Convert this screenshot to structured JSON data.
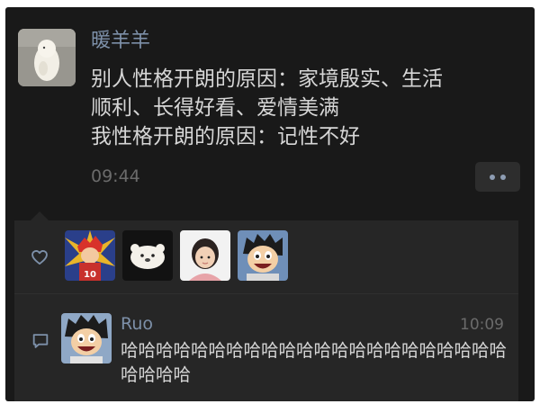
{
  "post": {
    "username": "暖羊羊",
    "text_lines": [
      "别人性格开朗的原因：家境殷实、生活",
      "顺利、长得好看、爱情美满",
      "我性格开朗的原因：记性不好"
    ],
    "time": "09:44",
    "avatar_icon": "white-bird-photo"
  },
  "likes": {
    "icon": "heart-icon",
    "avatars": [
      {
        "icon": "anime-basketball-player-avatar"
      },
      {
        "icon": "white-bear-avatar"
      },
      {
        "icon": "child-photo-avatar"
      },
      {
        "icon": "luffy-cartoon-avatar"
      }
    ]
  },
  "comment": {
    "icon": "comment-icon",
    "author": "Ruo",
    "time": "10:09",
    "text": "哈哈哈哈哈哈哈哈哈哈哈哈哈哈哈哈哈哈哈哈哈哈哈哈哈哈",
    "avatar_icon": "luffy-cartoon-avatar"
  },
  "colors": {
    "background": "#191919",
    "panel": "#262626",
    "name_link": "#7d90a9",
    "text": "#d6d6d6",
    "muted": "#6b6b6b"
  }
}
